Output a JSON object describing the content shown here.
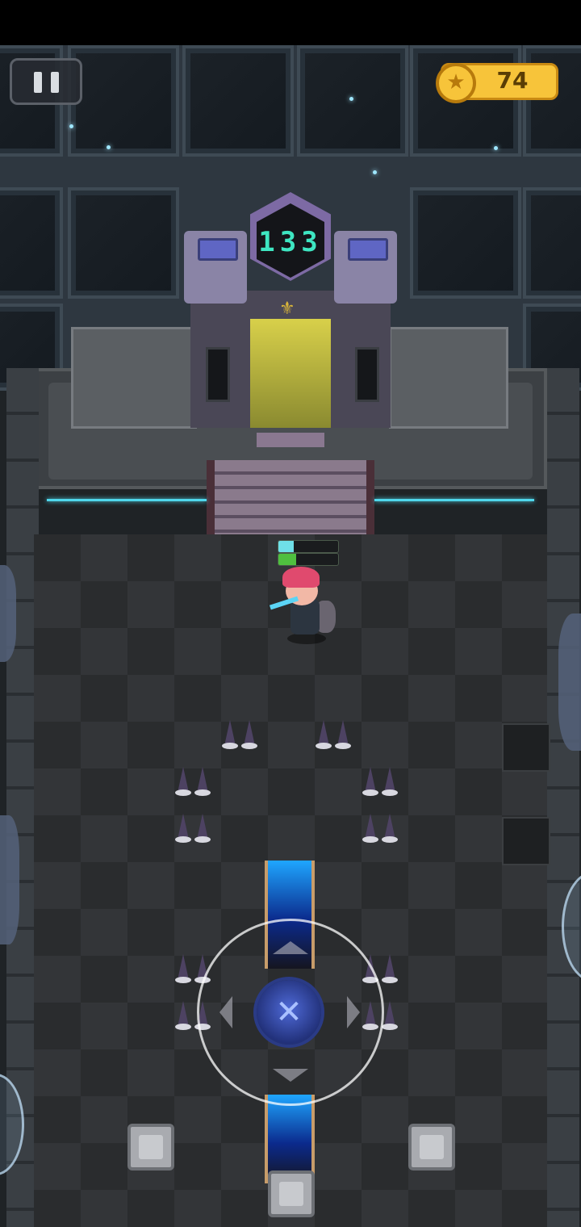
{
  "hud": {
    "pause_icon": "pause-icon",
    "coin_icon": "star-coin-icon",
    "coins": "74"
  },
  "level": {
    "floor_number": "133",
    "elevator_emblem": "fleur-de-lis-icon"
  },
  "player": {
    "shield_level": 0.25,
    "health_level": 0.3,
    "weapon": "spear"
  },
  "controls": {
    "joystick_center_icon": "cross-icon",
    "directions": [
      "up",
      "down",
      "left",
      "right"
    ]
  },
  "colors": {
    "coin": "#f7c43a",
    "floor_display": "#3ee6c2",
    "shield_bar": "#6fe0e8",
    "health_bar": "#4fbf3f",
    "accent_line": "#4fd7ec"
  }
}
